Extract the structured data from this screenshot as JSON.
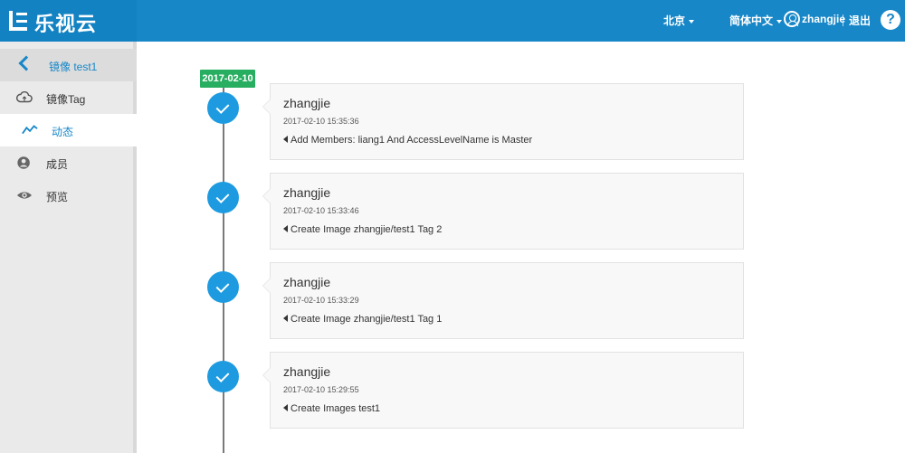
{
  "header": {
    "logo_text": "乐视云",
    "region": "北京",
    "language": "简体中文",
    "username": "zhangjie",
    "logout": "退出",
    "help": "?"
  },
  "sidebar": {
    "back_label": "镜像 test1",
    "items": [
      {
        "label": "镜像Tag",
        "icon": "cloud-upload-icon",
        "active": false
      },
      {
        "label": "动态",
        "icon": "activity-line-icon",
        "active": true
      },
      {
        "label": "成员",
        "icon": "person-icon",
        "active": false
      },
      {
        "label": "预览",
        "icon": "eye-icon",
        "active": false
      }
    ]
  },
  "timeline": {
    "date": "2017-02-10",
    "events": [
      {
        "user": "zhangjie",
        "time": "2017-02-10 15:35:36",
        "message": "Add Members: liang1 And AccessLevelName is Master"
      },
      {
        "user": "zhangjie",
        "time": "2017-02-10 15:33:46",
        "message": "Create Image zhangjie/test1 Tag 2"
      },
      {
        "user": "zhangjie",
        "time": "2017-02-10 15:33:29",
        "message": "Create Image zhangjie/test1 Tag 1"
      },
      {
        "user": "zhangjie",
        "time": "2017-02-10 15:29:55",
        "message": "Create Images test1"
      }
    ]
  },
  "colors": {
    "header_bg": "#1787c8",
    "accent": "#1787c8",
    "date_badge": "#27ae60",
    "timeline_dot": "#1e9be0"
  }
}
